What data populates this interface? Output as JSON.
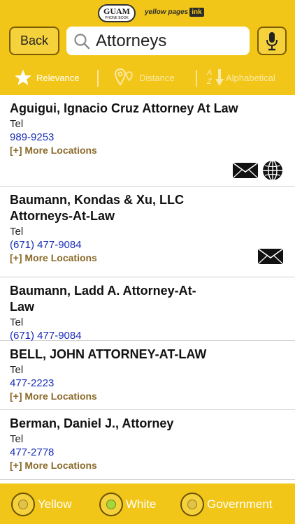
{
  "header": {
    "guam_logo_line1": "GUAM",
    "guam_logo_line2": "PHONE BOOK",
    "yp_logo_text": "yellow pages",
    "yp_logo_ink": "ink",
    "back_label": "Back",
    "search_value": "Attorneys"
  },
  "sort": {
    "relevance": "Relevance",
    "distance": "Distance",
    "alphabetical": "Alphabetical",
    "alpha_icon_a": "A",
    "alpha_icon_z": "Z",
    "active": "relevance"
  },
  "listings": [
    {
      "name": "Aguigui, Ignacio Cruz Attorney At Law",
      "tel_label": "Tel",
      "tel": "989-9253",
      "more": "[+] More Locations",
      "icons": [
        "envelope-icon",
        "globe-icon"
      ]
    },
    {
      "name": "Baumann, Kondas & Xu, LLC Attorneys-At-Law",
      "tel_label": "Tel",
      "tel": "(671) 477-9084",
      "more": "[+] More Locations",
      "icons": [
        "envelope-icon"
      ]
    },
    {
      "name": "Baumann, Ladd A. Attorney-At-Law",
      "tel_label": "Tel",
      "tel": "(671) 477-9084",
      "more": "",
      "icons": []
    },
    {
      "name": "BELL, JOHN ATTORNEY-AT-LAW",
      "tel_label": "Tel",
      "tel": "477-2223",
      "more": "[+] More Locations",
      "icons": []
    },
    {
      "name": "Berman, Daniel J., Attorney",
      "tel_label": "Tel",
      "tel": "477-2778",
      "more": "[+] More Locations",
      "icons": []
    }
  ],
  "footer": {
    "yellow_label": "Yellow",
    "white_label": "White",
    "government_label": "Government",
    "selected": "white"
  },
  "colors": {
    "brand_yellow": "#f2c618",
    "phone_blue": "#1a2fb5",
    "more_brown": "#8a6a2a"
  }
}
